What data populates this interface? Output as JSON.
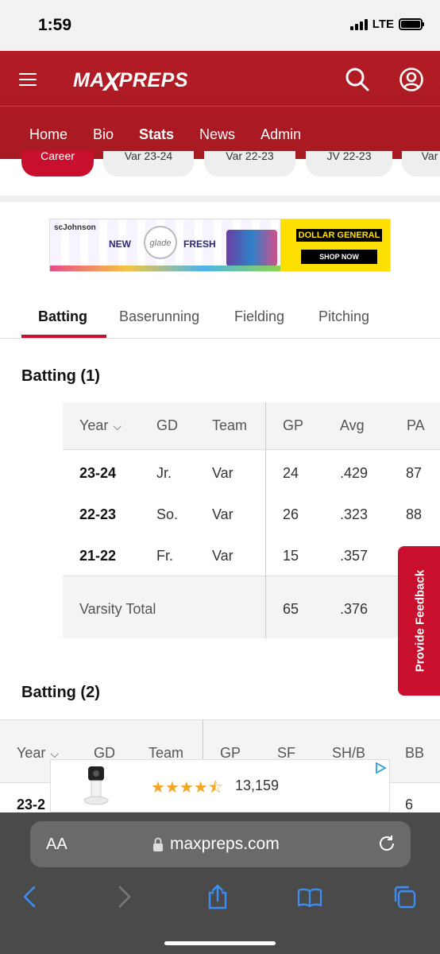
{
  "status_bar": {
    "time": "1:59",
    "network": "LTE"
  },
  "header": {
    "logo_left": "MA",
    "logo_x": "X",
    "logo_right": "PREPS",
    "nav": [
      "Home",
      "Bio",
      "Stats",
      "News",
      "Admin"
    ],
    "active_nav": "Stats"
  },
  "season_pills": [
    "Career",
    "Var 23-24",
    "Var 22-23",
    "JV 22-23",
    "Var"
  ],
  "ad_banner": {
    "brand": "scJohnson",
    "left_word": "NEW",
    "product": "glade",
    "right_word": "FRESH",
    "retailer": "DOLLAR GENERAL",
    "cta": "SHOP NOW"
  },
  "stat_tabs": [
    "Batting",
    "Baserunning",
    "Fielding",
    "Pitching"
  ],
  "batting1": {
    "title": "Batting (1)",
    "columns": [
      "Year",
      "GD",
      "Team",
      "GP",
      "Avg",
      "PA"
    ],
    "rows": [
      [
        "23-24",
        "Jr.",
        "Var",
        "24",
        ".429",
        "87"
      ],
      [
        "22-23",
        "So.",
        "Var",
        "26",
        ".323",
        "88"
      ],
      [
        "21-22",
        "Fr.",
        "Var",
        "15",
        ".357",
        ""
      ]
    ],
    "total": {
      "label": "Varsity Total",
      "gp": "65",
      "avg": ".376"
    }
  },
  "batting2": {
    "title": "Batting (2)",
    "columns": [
      "Year",
      "GD",
      "Team",
      "GP",
      "SF",
      "SH/B",
      "BB"
    ],
    "first_row": {
      "year": "23-2",
      "bb": "6"
    }
  },
  "feedback": {
    "label": "Provide Feedback"
  },
  "ad2": {
    "stars": "★★★★⯪",
    "count": "13,159"
  },
  "safari": {
    "aa": "AA",
    "url": "maxpreps.com"
  }
}
